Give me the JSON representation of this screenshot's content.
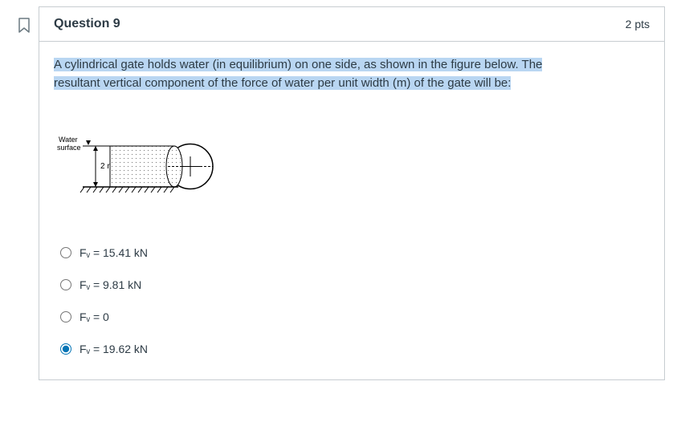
{
  "question": {
    "title": "Question 9",
    "points": "2 pts",
    "prompt_line1": "A cylindrical gate holds water (in equilibrium) on one side, as shown in the figure below. The ",
    "prompt_line2": "resultant vertical component of the force of water per unit width (m) of the gate will be:"
  },
  "figure": {
    "label_water": "Water",
    "label_surface": "surface",
    "dimension": "2 m"
  },
  "options": {
    "a": "Fᵥ = 15.41 kN",
    "b": "Fᵥ = 9.81 kN",
    "c": "Fᵥ = 0",
    "d": "Fᵥ = 19.62 kN"
  },
  "selected": "d"
}
